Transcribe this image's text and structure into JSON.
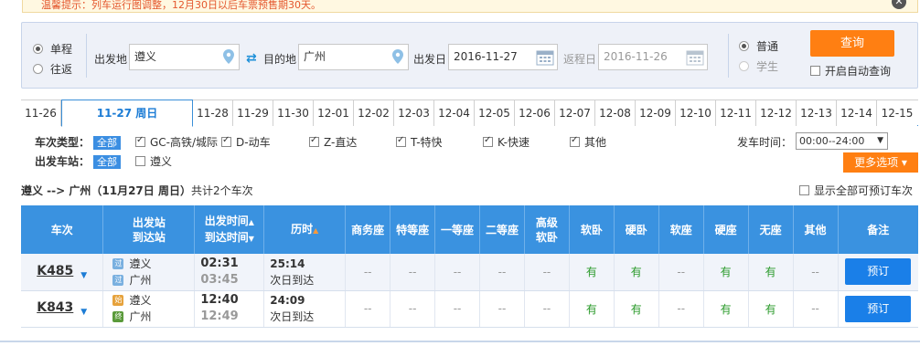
{
  "notice": {
    "label": "温馨提示：",
    "text": "列车运行图调整，12月30日以后车票预售期30天。"
  },
  "trip_type": {
    "single": "单程",
    "round": "往返"
  },
  "from": {
    "label": "出发地",
    "value": "遵义"
  },
  "to": {
    "label": "目的地",
    "value": "广州"
  },
  "depart_date": {
    "label": "出发日",
    "value": "2016-11-27"
  },
  "return_date": {
    "label": "返程日",
    "value": "2016-11-26"
  },
  "ticket_type": {
    "normal": "普通",
    "student": "学生"
  },
  "query_button": "查询",
  "auto_query": "开启自动查询",
  "dates": [
    {
      "label": "11-26"
    },
    {
      "label": "11-27 周日"
    },
    {
      "label": "11-28"
    },
    {
      "label": "11-29"
    },
    {
      "label": "11-30"
    },
    {
      "label": "12-01"
    },
    {
      "label": "12-02"
    },
    {
      "label": "12-03"
    },
    {
      "label": "12-04"
    },
    {
      "label": "12-05"
    },
    {
      "label": "12-06"
    },
    {
      "label": "12-07"
    },
    {
      "label": "12-08"
    },
    {
      "label": "12-09"
    },
    {
      "label": "12-10"
    },
    {
      "label": "12-11"
    },
    {
      "label": "12-12"
    },
    {
      "label": "12-13"
    },
    {
      "label": "12-14"
    },
    {
      "label": "12-15"
    }
  ],
  "filters": {
    "train_type_label": "车次类型：",
    "all": "全部",
    "types": [
      "GC-高铁/城际",
      "D-动车",
      "Z-直达",
      "T-特快",
      "K-快速",
      "其他"
    ],
    "station_label": "出发车站：",
    "stations": [
      "遵义"
    ],
    "time_label": "发车时间：",
    "time_value": "00:00--24:00",
    "more": "更多选项"
  },
  "summary": {
    "route": "遵义 --> 广州（11月27日 周日）",
    "count": "共计2个车次"
  },
  "show_all": "显示全部可预订车次",
  "table": {
    "headers": {
      "train": "车次",
      "station_a": "出发站",
      "station_b": "到达站",
      "time_a": "出发时间",
      "time_b": "到达时间",
      "duration": "历时",
      "business": "商务座",
      "special": "特等座",
      "first": "一等座",
      "second": "二等座",
      "hsoft_a": "高级",
      "hsoft_b": "软卧",
      "softsleep": "软卧",
      "hardsleep": "硬卧",
      "softseat": "软座",
      "hardseat": "硬座",
      "noseat": "无座",
      "other": "其他",
      "remark": "备注"
    },
    "rows": [
      {
        "train": "K485",
        "from_icon": "过",
        "from": "遵义",
        "to_icon": "过",
        "to": "广州",
        "depart": "02:31",
        "arrive": "03:45",
        "duration": "25:14",
        "arrive_note": "次日到达",
        "seats": [
          "--",
          "--",
          "--",
          "--",
          "--",
          "有",
          "有",
          "--",
          "有",
          "有",
          "--"
        ],
        "book": "预订"
      },
      {
        "train": "K843",
        "from_icon": "始",
        "from": "遵义",
        "to_icon": "终",
        "to": "广州",
        "depart": "12:40",
        "arrive": "12:49",
        "duration": "24:09",
        "arrive_note": "次日到达",
        "seats": [
          "--",
          "--",
          "--",
          "--",
          "--",
          "有",
          "有",
          "--",
          "有",
          "有",
          "--"
        ],
        "book": "预订"
      }
    ]
  }
}
